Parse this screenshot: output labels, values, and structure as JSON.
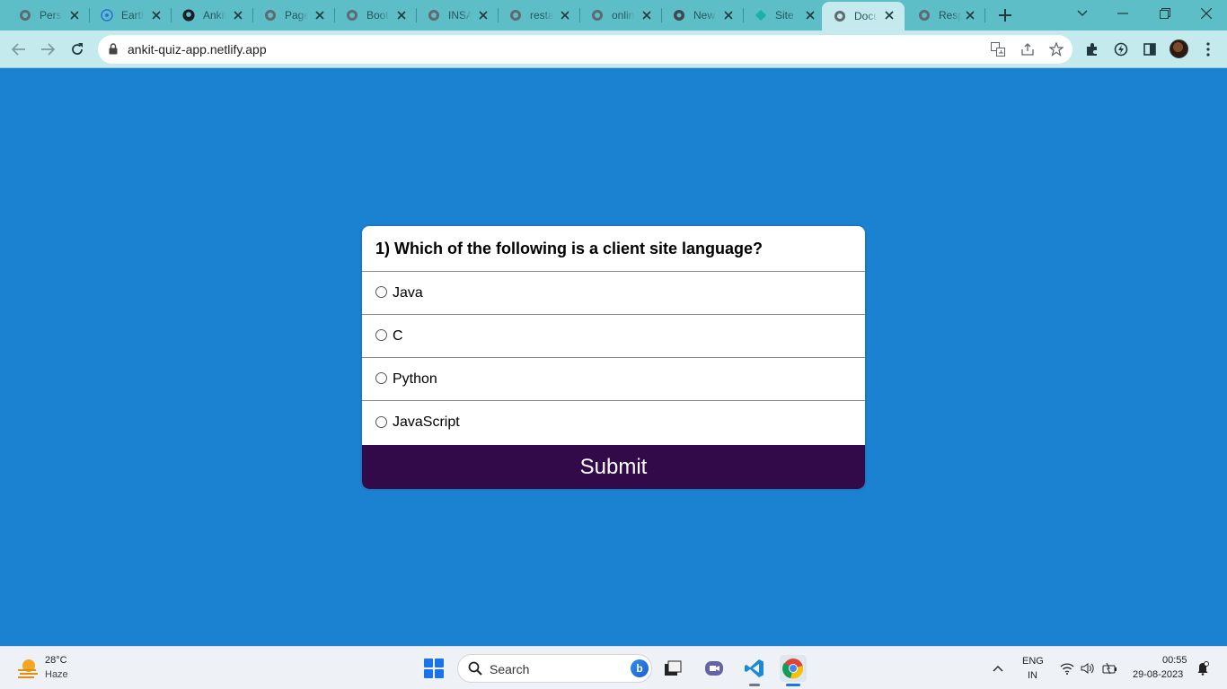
{
  "browser": {
    "tabs": [
      {
        "title": "Perso",
        "favicon": "globe-icon"
      },
      {
        "title": "Earth",
        "favicon": "earth-engine-icon"
      },
      {
        "title": "Ankit",
        "favicon": "github-icon"
      },
      {
        "title": "Page",
        "favicon": "globe-icon"
      },
      {
        "title": "Boot",
        "favicon": "globe-icon"
      },
      {
        "title": "INSA",
        "favicon": "globe-icon"
      },
      {
        "title": "resta",
        "favicon": "globe-icon"
      },
      {
        "title": "onlin",
        "favicon": "globe-icon"
      },
      {
        "title": "New",
        "favicon": "chrome-icon"
      },
      {
        "title": "Site",
        "favicon": "netlify-icon"
      },
      {
        "title": "Docu",
        "favicon": "globe-icon",
        "active": true
      },
      {
        "title": "Resp",
        "favicon": "globe-icon"
      }
    ],
    "url": "ankit-quiz-app.netlify.app",
    "colors": {
      "tabstrip": "#5ebec8",
      "toolbar": "#c5eaee"
    }
  },
  "quiz": {
    "question": "1) Which of the following is a client site language?",
    "options": [
      "Java",
      "C",
      "Python",
      "JavaScript"
    ],
    "submit_label": "Submit",
    "colors": {
      "background": "#1b82d2",
      "card": "#ffffff",
      "submit": "#320a4a"
    }
  },
  "taskbar": {
    "weather_temp": "28°C",
    "weather_desc": "Haze",
    "search_placeholder": "Search",
    "lang_line1": "ENG",
    "lang_line2": "IN",
    "time": "00:55",
    "date": "29-08-2023"
  }
}
